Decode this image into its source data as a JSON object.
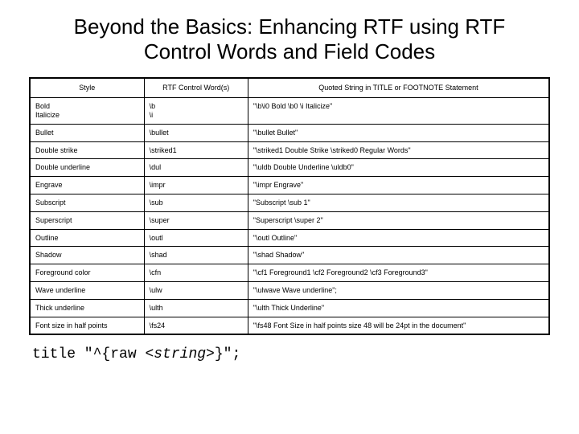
{
  "title": "Beyond the Basics: Enhancing RTF using RTF Control Words and Field Codes",
  "headers": {
    "col1": "Style",
    "col2": "RTF Control Word(s)",
    "col3": "Quoted String in TITLE or FOOTNOTE Statement"
  },
  "rows": [
    {
      "style": "Bold\nItalicize",
      "word": "\\b\n\\i",
      "quoted": "\"\\b\\i0 Bold \\b0 \\i Italicize\""
    },
    {
      "style": "Bullet",
      "word": "\\bullet",
      "quoted": "\"\\bullet Bullet\""
    },
    {
      "style": "Double strike",
      "word": "\\striked1",
      "quoted": "\"\\striked1 Double Strike \\striked0 Regular Words\""
    },
    {
      "style": "Double underline",
      "word": "\\dul",
      "quoted": "\"\\uldb Double Underline \\uldb0\""
    },
    {
      "style": "Engrave",
      "word": "\\impr",
      "quoted": "\"\\impr Engrave\""
    },
    {
      "style": "Subscript",
      "word": "\\sub",
      "quoted": "\"Subscript \\sub 1\""
    },
    {
      "style": "Superscript",
      "word": "\\super",
      "quoted": "\"Superscript \\super 2\""
    },
    {
      "style": "Outline",
      "word": "\\outl",
      "quoted": "\"\\outl Outline\""
    },
    {
      "style": "Shadow",
      "word": "\\shad",
      "quoted": "\"\\shad Shadow\""
    },
    {
      "style": "Foreground color",
      "word": "\\cfn",
      "quoted": "\"\\cf1 Foreground1 \\cf2 Foreground2 \\cf3 Foreground3\""
    },
    {
      "style": "Wave underline",
      "word": "\\ulw",
      "quoted": "\"\\ulwave Wave underline\";"
    },
    {
      "style": "Thick underline",
      "word": "\\ulth",
      "quoted": "\"\\ulth Thick Underline\""
    },
    {
      "style": "Font size in half points",
      "word": "\\fs24",
      "quoted": "\"\\fs48 Font Size in half points size 48 will be 24pt in the document\""
    }
  ],
  "footer": {
    "prefix": "title \"^{raw ",
    "string": "<string>",
    "suffix": "}\";"
  }
}
